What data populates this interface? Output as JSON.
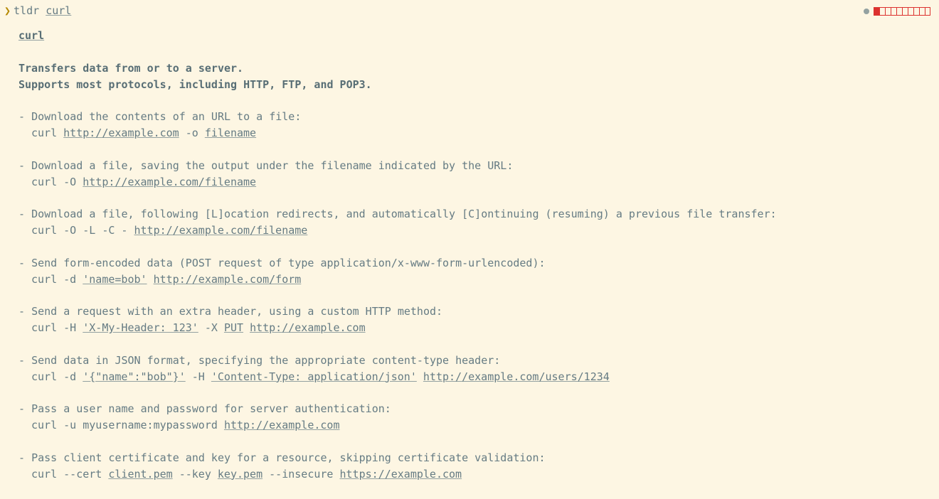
{
  "prompt": {
    "symbol": "❯",
    "command": "tldr",
    "arg": "curl"
  },
  "status": {
    "cells_total": 10,
    "cells_filled": 1
  },
  "page": {
    "title": "curl",
    "summary": "Transfers data from or to a server.\nSupports most protocols, including HTTP, FTP, and POP3.",
    "examples": [
      {
        "desc": "Download the contents of an URL to a file:",
        "cmd": [
          {
            "t": "curl ",
            "u": false
          },
          {
            "t": "http://example.com",
            "u": true
          },
          {
            "t": " -o ",
            "u": false
          },
          {
            "t": "filename",
            "u": true
          }
        ]
      },
      {
        "desc": "Download a file, saving the output under the filename indicated by the URL:",
        "cmd": [
          {
            "t": "curl -O ",
            "u": false
          },
          {
            "t": "http://example.com/filename",
            "u": true
          }
        ]
      },
      {
        "desc": "Download a file, following [L]ocation redirects, and automatically [C]ontinuing (resuming) a previous file transfer:",
        "cmd": [
          {
            "t": "curl -O -L -C - ",
            "u": false
          },
          {
            "t": "http://example.com/filename",
            "u": true
          }
        ]
      },
      {
        "desc": "Send form-encoded data (POST request of type application/x-www-form-urlencoded):",
        "cmd": [
          {
            "t": "curl -d ",
            "u": false
          },
          {
            "t": "'name=bob'",
            "u": true
          },
          {
            "t": " ",
            "u": false
          },
          {
            "t": "http://example.com/form",
            "u": true
          }
        ]
      },
      {
        "desc": "Send a request with an extra header, using a custom HTTP method:",
        "cmd": [
          {
            "t": "curl -H ",
            "u": false
          },
          {
            "t": "'X-My-Header: 123'",
            "u": true
          },
          {
            "t": " -X ",
            "u": false
          },
          {
            "t": "PUT",
            "u": true
          },
          {
            "t": " ",
            "u": false
          },
          {
            "t": "http://example.com",
            "u": true
          }
        ]
      },
      {
        "desc": "Send data in JSON format, specifying the appropriate content-type header:",
        "cmd": [
          {
            "t": "curl -d ",
            "u": false
          },
          {
            "t": "'{\"name\":\"bob\"}'",
            "u": true
          },
          {
            "t": " -H ",
            "u": false
          },
          {
            "t": "'Content-Type: application/json'",
            "u": true
          },
          {
            "t": " ",
            "u": false
          },
          {
            "t": "http://example.com/users/1234",
            "u": true
          }
        ]
      },
      {
        "desc": "Pass a user name and password for server authentication:",
        "cmd": [
          {
            "t": "curl -u myusername:mypassword ",
            "u": false
          },
          {
            "t": "http://example.com",
            "u": true
          }
        ]
      },
      {
        "desc": "Pass client certificate and key for a resource, skipping certificate validation:",
        "cmd": [
          {
            "t": "curl --cert ",
            "u": false
          },
          {
            "t": "client.pem",
            "u": true
          },
          {
            "t": " --key ",
            "u": false
          },
          {
            "t": "key.pem",
            "u": true
          },
          {
            "t": " --insecure ",
            "u": false
          },
          {
            "t": "https://example.com",
            "u": true
          }
        ]
      }
    ]
  }
}
